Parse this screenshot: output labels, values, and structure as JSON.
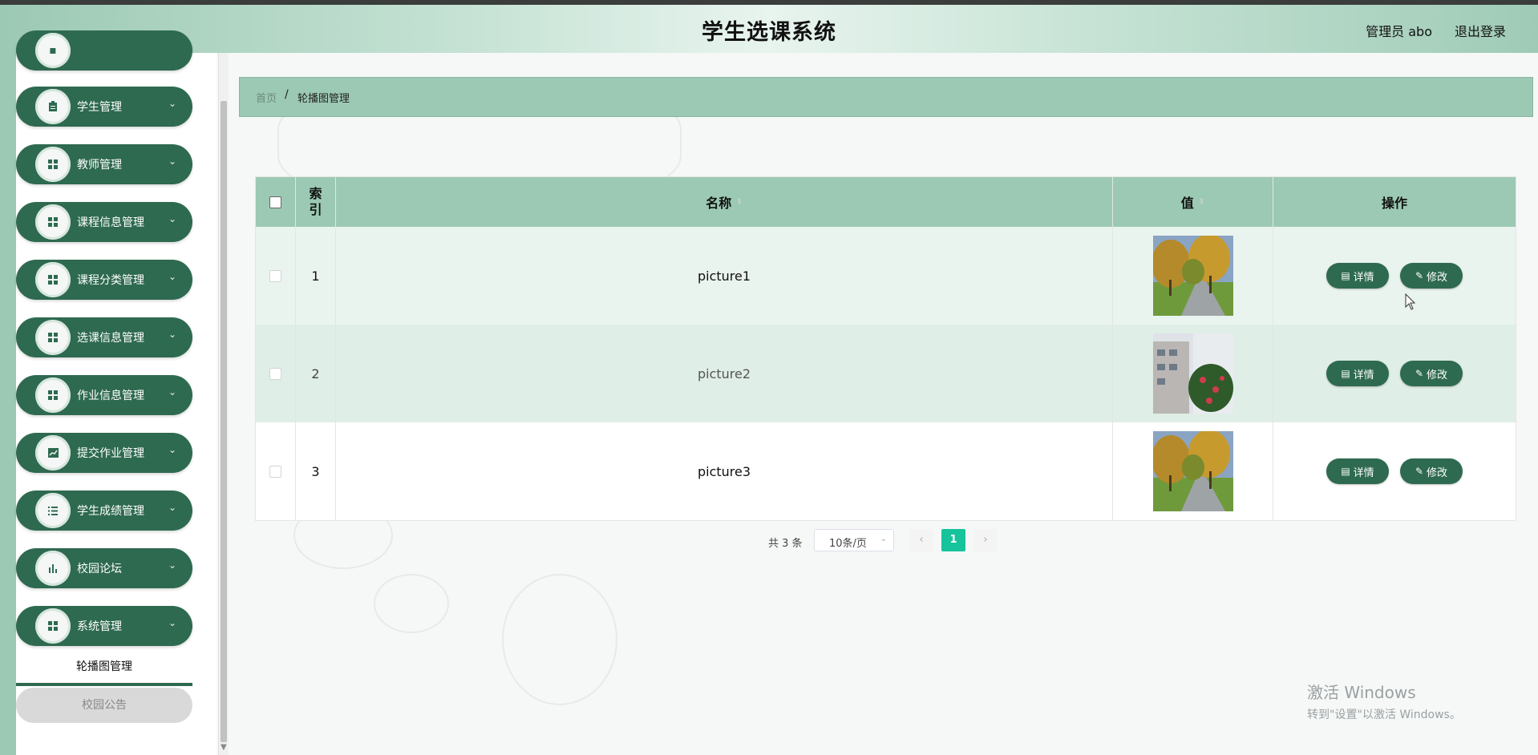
{
  "header": {
    "title": "学生选课系统",
    "user": "管理员 abo",
    "logout": "退出登录"
  },
  "sidebar": {
    "items": [
      {
        "label": "学生管理",
        "icon": "clipboard-icon"
      },
      {
        "label": "教师管理",
        "icon": "grid-icon"
      },
      {
        "label": "课程信息管理",
        "icon": "grid-icon"
      },
      {
        "label": "课程分类管理",
        "icon": "grid-icon"
      },
      {
        "label": "选课信息管理",
        "icon": "grid-icon"
      },
      {
        "label": "作业信息管理",
        "icon": "grid-icon"
      },
      {
        "label": "提交作业管理",
        "icon": "trend-chart-icon"
      },
      {
        "label": "学生成绩管理",
        "icon": "list-icon"
      },
      {
        "label": "校园论坛",
        "icon": "bar-chart-icon"
      },
      {
        "label": "系统管理",
        "icon": "grid-icon"
      }
    ],
    "submenu": {
      "active": "轮播图管理",
      "other": "校园公告"
    }
  },
  "breadcrumb": {
    "home": "首页",
    "separator": "/",
    "current": "轮播图管理"
  },
  "table": {
    "headers": {
      "index": "索\n引",
      "name": "名称",
      "value": "值",
      "actions": "操作"
    },
    "rows": [
      {
        "index": "1",
        "name": "picture1",
        "image": "campus-trees"
      },
      {
        "index": "2",
        "name": "picture2",
        "image": "building-flowers"
      },
      {
        "index": "3",
        "name": "picture3",
        "image": "campus-trees"
      }
    ],
    "actions": {
      "detail": "详情",
      "edit": "修改"
    }
  },
  "pagination": {
    "total": "共 3 条",
    "page_size": "10条/页",
    "current_page": "1",
    "prev": "‹",
    "next": "›"
  },
  "watermark": {
    "line1": "激活 Windows",
    "line2": "转到\"设置\"以激活 Windows。"
  },
  "colors": {
    "primary": "#2e6a50",
    "header_bg": "#9cc9b3",
    "page_active": "#16c39b"
  }
}
